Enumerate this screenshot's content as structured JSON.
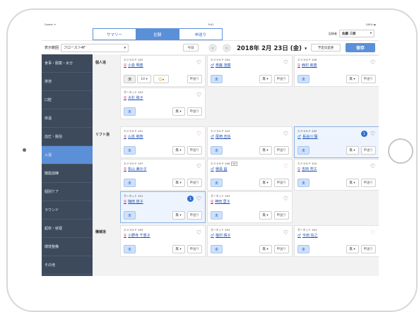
{
  "statusbar": {
    "left": "Carrier ᯤ",
    "time": "9:41",
    "right": "100% ▬"
  },
  "tabs": [
    "サマリー",
    "記録",
    "申送り"
  ],
  "recorder": {
    "label": "記録者",
    "value": "佐藤 三郎"
  },
  "filter": {
    "label": "表示範囲",
    "floor": "フロース＞4F"
  },
  "today": "今日",
  "date": "2018年 2月 23日 (金)",
  "change_label": "予定日変更",
  "save_label": "保存",
  "sidebar": [
    "食事・服薬・水分",
    "排泄",
    "口腔",
    "体温",
    "血圧・脈拍",
    "入浴",
    "機能訓練",
    "個別ケア",
    "ラウンド",
    "起床・就寝",
    "環境整備",
    "その他"
  ],
  "categories": [
    "個人浴",
    "リフト浴",
    "機械浴"
  ],
  "cards": [
    {
      "room": "エメラルド 403",
      "name": "小泉 明恵",
      "gender": "female",
      "heart": "plain",
      "controls": "full",
      "sel": "10",
      "un": "済"
    },
    {
      "room": "エメラルド 404",
      "name": "斎藤 茂樹",
      "gender": "male",
      "heart": "plain",
      "un": "未",
      "sel": "無"
    },
    {
      "room": "エメラルド 406",
      "name": "西村 和恵",
      "gender": "female",
      "heart": "plain",
      "un": "未",
      "sel": "無"
    },
    {
      "room": "ガーネット 453",
      "name": "大杉 和子",
      "gender": "female",
      "heart": "plain",
      "un": "未",
      "sel": "無"
    },
    {
      "room": "エメラルド 401",
      "name": "山本 和枝",
      "gender": "female",
      "heart": "red",
      "un": "未",
      "sel": "無"
    },
    {
      "room": "エメラルド 402",
      "name": "尾崎 吉信",
      "gender": "male",
      "heart": "plain",
      "un": "未",
      "sel": "無"
    },
    {
      "room": "エメラルド 405",
      "name": "長谷川 陽",
      "gender": "male",
      "heart": "plain",
      "un": "未",
      "sel": "無",
      "badge": "1"
    },
    {
      "room": "エメラルド 407",
      "name": "松山 美沙子",
      "gender": "female",
      "heart": "plain",
      "un": "未",
      "sel": "無"
    },
    {
      "room": "エメラルド 408",
      "tag": "BB",
      "name": "徳員 昌",
      "gender": "male",
      "heart": "pink",
      "un": "未",
      "sel": "無"
    },
    {
      "room": "エメラルド 410",
      "name": "吉田 芳江",
      "gender": "female",
      "heart": "plain",
      "un": "未",
      "sel": "無"
    },
    {
      "room": "ガーネット 451",
      "name": "梅田 佳子",
      "gender": "female",
      "heart": "plain",
      "un": "未",
      "sel": "無",
      "badge": "1"
    },
    {
      "room": "ガーネット 453",
      "name": "神田 里子",
      "gender": "female",
      "heart": "plain",
      "un": "未",
      "sel": "無"
    },
    {
      "room": "エメラルド 409",
      "name": "小野寺 千恵子",
      "gender": "female",
      "heart": "plain",
      "un": "未",
      "sel": "無"
    },
    {
      "room": "ガーネット 452",
      "name": "植村 晴子",
      "gender": "male",
      "heart": "plain",
      "un": "未",
      "sel": "無"
    },
    {
      "room": "ガーネット 454",
      "name": "今田 信之",
      "gender": "male",
      "heart": "pink",
      "un": "未",
      "sel": "無"
    }
  ],
  "send_label": "申送り",
  "colors": {
    "accent": "#5b8fd8",
    "sidebar": "#3c4a5c"
  }
}
